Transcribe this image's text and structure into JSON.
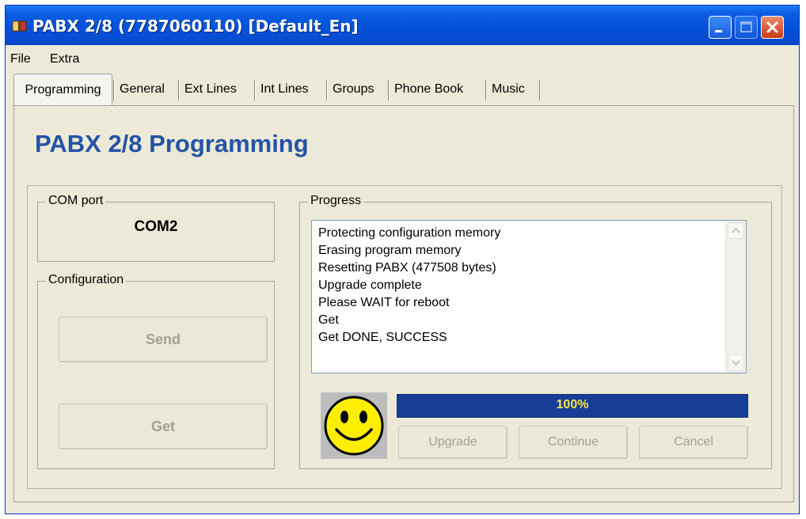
{
  "window": {
    "title": "PABX 2/8 (7787060110) [Default_En]"
  },
  "menu": {
    "items": [
      "File",
      "Extra"
    ]
  },
  "tabs": [
    "Programming",
    "General",
    "Ext Lines",
    "Int Lines",
    "Groups",
    "Phone Book",
    "Music"
  ],
  "active_tab": "Programming",
  "page": {
    "title": "PABX 2/8 Programming"
  },
  "com_port": {
    "label": "COM port",
    "value": "COM2"
  },
  "configuration": {
    "label": "Configuration",
    "send": "Send",
    "get": "Get"
  },
  "progress": {
    "label": "Progress",
    "log": [
      "Protecting configuration memory",
      "Erasing program memory",
      "Resetting PABX (477508 bytes)",
      "Upgrade complete",
      "Please WAIT for reboot",
      "Get",
      "Get DONE, SUCCESS"
    ],
    "percent_text": "100%",
    "fraction": 1.0,
    "status_icon": "smiley-face-icon"
  },
  "actions": {
    "upgrade": "Upgrade",
    "continue": "Continue",
    "cancel": "Cancel"
  },
  "colors": {
    "title_bar": "#0550db",
    "heading": "#2453a6",
    "progress_bar": "#173f97",
    "progress_text": "#ffe34d"
  }
}
